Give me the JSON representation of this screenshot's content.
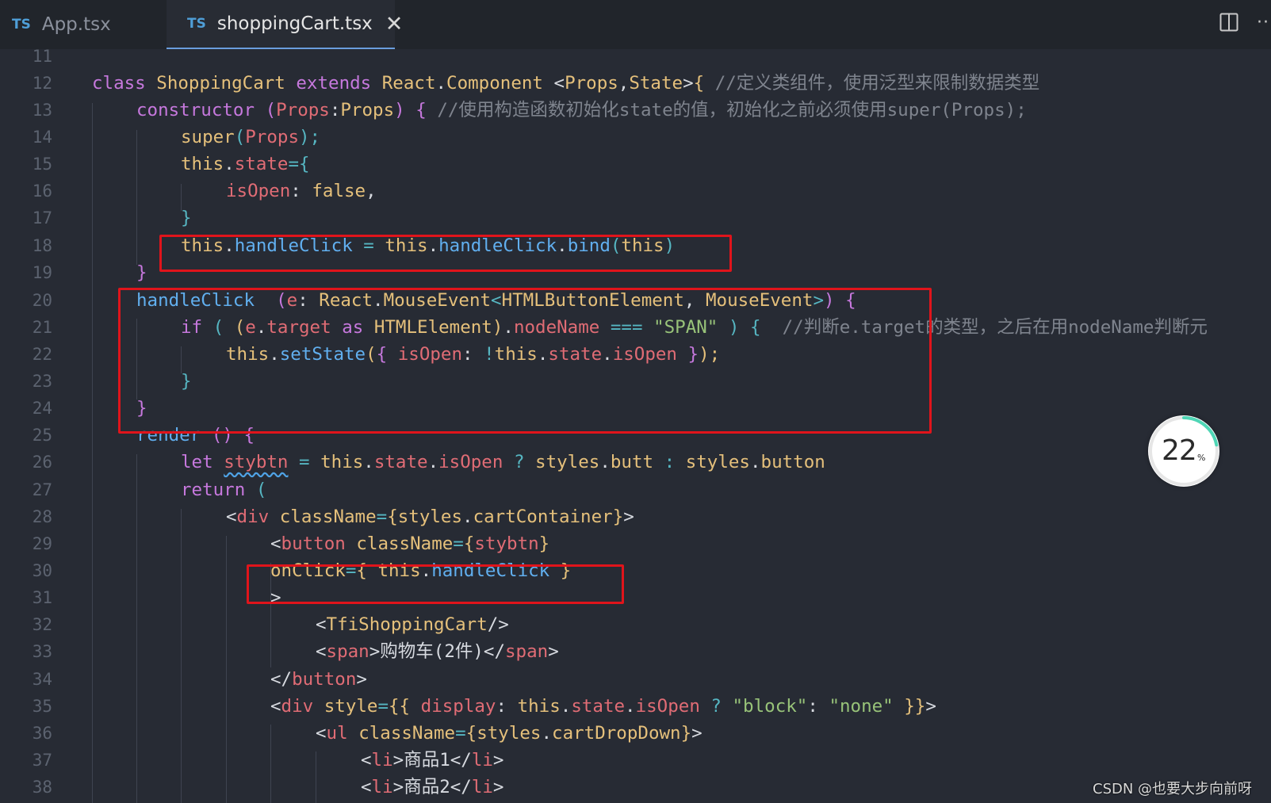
{
  "tabs": [
    {
      "type_badge": "TS",
      "label": "App.tsx",
      "active": false
    },
    {
      "type_badge": "TS",
      "label": "shoppingCart.tsx",
      "active": true,
      "close_glyph": "✕"
    }
  ],
  "toolbar": {
    "split_icon": "split-editor-icon",
    "more_icon": "ellipsis-icon",
    "more_glyph": "···"
  },
  "editor": {
    "line_numbers": [
      "11",
      "12",
      "13",
      "14",
      "15",
      "16",
      "17",
      "18",
      "19",
      "20",
      "21",
      "22",
      "23",
      "24",
      "25",
      "26",
      "27",
      "28",
      "29",
      "30",
      "31",
      "32",
      "33",
      "34",
      "35",
      "36",
      "37",
      "38"
    ],
    "tokens": {
      "l12": [
        "class",
        "ShoppingCart",
        "extends",
        "React",
        ".",
        "Component",
        "<",
        "Props",
        ",",
        "State",
        ">",
        "{",
        "//定义类组件，使用泛型来限制数据类型"
      ],
      "l13": [
        "constructor",
        "(",
        "Props",
        ":",
        "Props",
        ")",
        "{",
        "//使用构造函数初始化state的值，初始化之前必须使用super(Props);"
      ],
      "l14": [
        "super",
        "(",
        "Props",
        ");"
      ],
      "l15": [
        "this",
        ".",
        "state",
        "=",
        "{"
      ],
      "l16": [
        "isOpen",
        ": ",
        "false",
        ","
      ],
      "l17": [
        "}"
      ],
      "l18": [
        "this",
        ".",
        "handleClick",
        "=",
        "this",
        ".",
        "handleClick",
        ".",
        "bind",
        "(",
        "this",
        ")"
      ],
      "l19": [
        "}"
      ],
      "l20": [
        "handleClick",
        "(",
        "e",
        ": ",
        "React",
        ".",
        "MouseEvent",
        "<",
        "HTMLButtonElement",
        ", ",
        "MouseEvent",
        ">",
        ")",
        "{"
      ],
      "l21": [
        "if",
        "(",
        "(",
        "e",
        ".",
        "target",
        "as",
        "HTMLElement",
        ")",
        ".",
        "nodeName",
        "===",
        "\"SPAN\"",
        ")",
        "{",
        "//判断e.target的类型，之后在用nodeName判断元"
      ],
      "l22": [
        "this",
        ".",
        "setState",
        "(",
        "{",
        "isOpen",
        ":",
        "!",
        "this",
        ".",
        "state",
        ".",
        "isOpen",
        "}",
        ");"
      ],
      "l23": [
        "}"
      ],
      "l24": [
        "}"
      ],
      "l25": [
        "render",
        "()",
        "{"
      ],
      "l26": [
        "let",
        "stybtn",
        "=",
        "this",
        ".",
        "state",
        ".",
        "isOpen",
        "?",
        "styles",
        ".",
        "butt",
        ":",
        "styles",
        ".",
        "button"
      ],
      "l27": [
        "return",
        "("
      ],
      "l28": [
        "<",
        "div",
        "className",
        "=",
        "{",
        "styles",
        ".",
        "cartContainer",
        "}",
        ">"
      ],
      "l29": [
        "<",
        "button",
        "className",
        "=",
        "{",
        "stybtn",
        "}"
      ],
      "l30": [
        "onClick",
        "=",
        "{",
        "this",
        ".",
        "handleClick",
        "}"
      ],
      "l31": [
        ">"
      ],
      "l32": [
        "<",
        "TfiShoppingCart",
        "/>"
      ],
      "l33": [
        "<",
        "span",
        ">",
        "购物车(2件)",
        "</",
        "span",
        ">"
      ],
      "l34": [
        "</",
        "button",
        ">"
      ],
      "l35": [
        "<",
        "div",
        "style",
        "=",
        "{{",
        "display",
        ":",
        "this",
        ".",
        "state",
        ".",
        "isOpen",
        "?",
        "\"block\"",
        ":",
        "\"none\"",
        "}}",
        ">"
      ],
      "l36": [
        "<",
        "ul",
        "className",
        "=",
        "{",
        "styles",
        ".",
        "cartDropDown",
        "}",
        ">"
      ],
      "l37": [
        "<",
        "li",
        ">",
        "商品1",
        "</",
        "li",
        ">"
      ],
      "l38": [
        "<",
        "li",
        ">",
        "商品2",
        "</",
        "li",
        ">"
      ]
    }
  },
  "annotations": {
    "color": "#e0141b",
    "count": 3
  },
  "progress": {
    "value": "22",
    "unit": "%",
    "percent": 22,
    "ring_color": "#4fd6b6"
  },
  "watermark": "CSDN @也要大步向前呀",
  "colors": {
    "background": "#272b34",
    "keyword": "#c678dd",
    "type": "#e5c07b",
    "function": "#61afef",
    "property": "#e06c75",
    "string": "#98c379",
    "comment": "#7f848e"
  }
}
